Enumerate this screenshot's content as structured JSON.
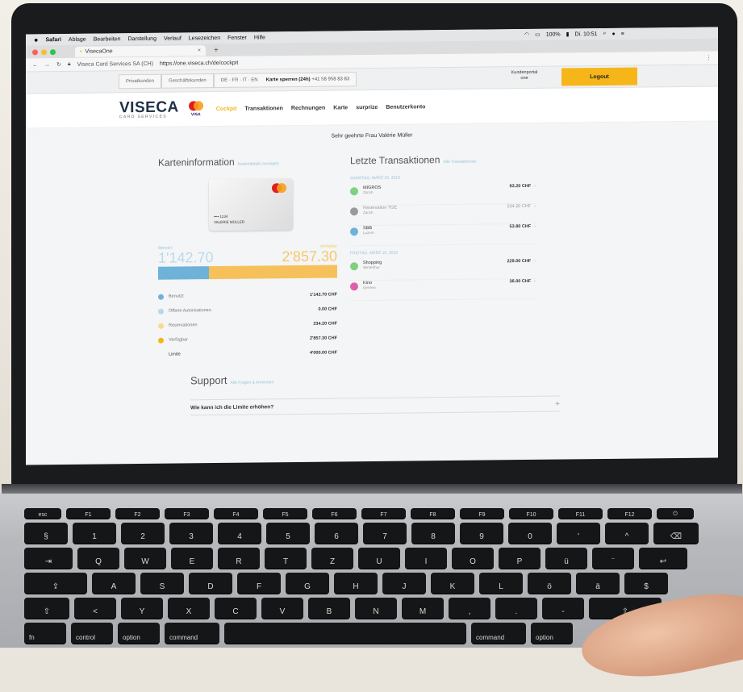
{
  "menubar": {
    "app": "Safari",
    "items": [
      "Ablage",
      "Bearbeiten",
      "Darstellung",
      "Verlauf",
      "Lesezeichen",
      "Fenster",
      "Hilfe"
    ],
    "battery": "100%",
    "clock": "Di. 10:51"
  },
  "browser": {
    "tab_title": "VisecaOne",
    "url_prefix": "Viseca Card Services SA (CH)",
    "url": "https://one.viseca.ch/de/cockpit"
  },
  "site": {
    "btn_privatkunden": "Privatkunden",
    "btn_geschaeftskunden": "Geschäftskunden",
    "langs": "DE · FR · IT · EN",
    "phone_label": "Karte sperren (24h)",
    "phone_number": "+41 58 958 83 83",
    "kundenportal": "Kundenportal one",
    "logout": "Logout",
    "logo": "VISECA",
    "logo_sub": "CARD SERVICES",
    "visa": "VISA",
    "nav": [
      "Cockpit",
      "Transaktionen",
      "Rechnungen",
      "Karte",
      "surprize",
      "Benutzerkonto"
    ],
    "greeting": "Sehr geehrte Frau Valérie Müller"
  },
  "cardinfo": {
    "title": "Karteninformation",
    "link": "Kartendetails anzeigen",
    "card_number": "•••• 1234",
    "card_name": "VALERIE MÜLLER",
    "label_used": "Benutzt",
    "label_available": "Verfügbar",
    "used": "1'142.70",
    "available": "2'857.30",
    "used_fraction": 0.2857,
    "rows": [
      {
        "label": "Benutzt",
        "value": "1'142.70 CHF",
        "color": "#6fb2d9"
      },
      {
        "label": "Offene Autorisationen",
        "value": "0.00 CHF",
        "color": "#b7d7ea"
      },
      {
        "label": "Reservationen",
        "value": "234.20 CHF",
        "color": "#f8d98f"
      },
      {
        "label": "Verfügbar",
        "value": "2'857.30 CHF",
        "color": "#f6b619"
      }
    ],
    "limit_label": "Limite",
    "limit_value": "4'000.00 CHF"
  },
  "transactions": {
    "title": "Letzte Transaktionen",
    "link": "Alle Transaktionen",
    "groups": [
      {
        "date": "SAMSTAG, MÄRZ 16, 2019",
        "items": [
          {
            "merchant": "MIGROS",
            "place": "Zürich",
            "amount": "93.20 CHF",
            "color": "#7fd17f"
          },
          {
            "merchant": "Reservation TGE",
            "place": "Zürich",
            "amount": "234.20 CHF",
            "color": "#9a9a9a"
          },
          {
            "merchant": "SBB",
            "place": "Luzern",
            "amount": "53.80 CHF",
            "color": "#6fb2d9"
          }
        ]
      },
      {
        "date": "FREITAG, MÄRZ 15, 2019",
        "items": [
          {
            "merchant": "Shopping",
            "place": "Winterthur",
            "amount": "229.00 CHF",
            "color": "#7fd17f"
          },
          {
            "merchant": "Kino",
            "place": "Genève",
            "amount": "36.00 CHF",
            "color": "#e05ea5"
          }
        ]
      }
    ]
  },
  "support": {
    "title": "Support",
    "link": "Alle Fragen & Antworten",
    "faq": "Wie kann ich die Limite erhöhen?"
  },
  "keyboard": {
    "fn_row": [
      "esc",
      "F1",
      "F2",
      "F3",
      "F4",
      "F5",
      "F6",
      "F7",
      "F8",
      "F9",
      "F10",
      "F11",
      "F12",
      "⏻"
    ],
    "row1": [
      "§",
      "1",
      "2",
      "3",
      "4",
      "5",
      "6",
      "7",
      "8",
      "9",
      "0",
      "'",
      "^",
      "⌫"
    ],
    "row2": [
      "⇥",
      "Q",
      "W",
      "E",
      "R",
      "T",
      "Z",
      "U",
      "I",
      "O",
      "P",
      "ü",
      "¨",
      "↩"
    ],
    "row3": [
      "⇪",
      "A",
      "S",
      "D",
      "F",
      "G",
      "H",
      "J",
      "K",
      "L",
      "ö",
      "ä",
      "$"
    ],
    "row4": [
      "⇧",
      "<",
      "Y",
      "X",
      "C",
      "V",
      "B",
      "N",
      "M",
      ",",
      ".",
      "-",
      "⇧"
    ],
    "mods": [
      "fn",
      "control",
      "option",
      "command",
      "",
      "command",
      "option"
    ]
  }
}
